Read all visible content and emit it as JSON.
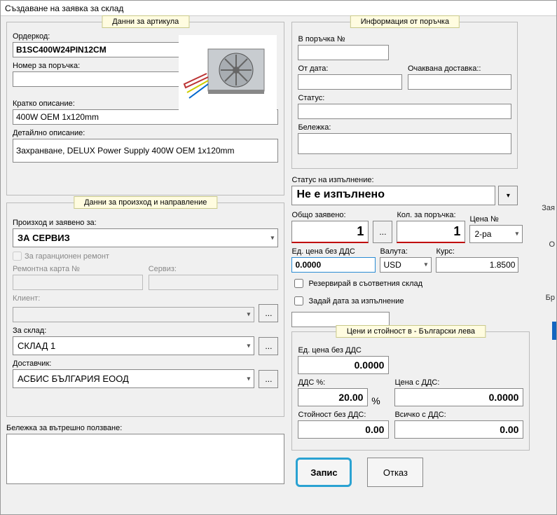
{
  "window": {
    "title": "Създаване на заявка за склад"
  },
  "article": {
    "legend": "Данни за артикула",
    "ordercode_label": "Ордеркод:",
    "ordercode": "B1SC400W24PIN12CM",
    "ordernum_label": "Номер за поръчка:",
    "ordernum": "",
    "short_label": "Кратко описание:",
    "short": "400W OEM 1x120mm",
    "detail_label": "Детайлно описание:",
    "detail": "Захранване, DELUX Power Supply 400W OEM 1x120mm"
  },
  "origin": {
    "legend": "Данни за произход и направление",
    "from_label": "Произход и заявено за:",
    "from": "ЗА СЕРВИЗ",
    "warranty_label": "За гаранционен ремонт",
    "repaircard_label": "Ремонтна карта №",
    "service_label": "Сервиз:",
    "repaircard": "",
    "service": "",
    "client_label": "Клиент:",
    "client": "",
    "for_sklad_label": "За склад:",
    "for_sklad": "СКЛАД 1",
    "supplier_label": "Доставчик:",
    "supplier": "АСБИС БЪЛГАРИЯ ЕООД"
  },
  "note": {
    "label": "Бележка за вътрешно ползване:",
    "value": ""
  },
  "orderinfo": {
    "legend": "Информация от поръчка",
    "ordno_label": "В поръчка №",
    "ordno": "",
    "fromdate_label": "От дата:",
    "fromdate": "",
    "expdeliv_label": "Очаквана доставка::",
    "expdeliv": "",
    "status_label": "Статус:",
    "status": "",
    "note_label": "Бележка:",
    "note": ""
  },
  "exec": {
    "status_label": "Статус на изпълнение:",
    "status": "Не е изпълнено",
    "total_label": "Общо заявено:",
    "total": "1",
    "qty_label": "Кол. за поръчка:",
    "qty": "1",
    "priceno_label": "Цена №",
    "priceno": "2-ра",
    "unitprice_label": "Ед. цена без ДДС",
    "unitprice": "0.0000",
    "currency_label": "Валута:",
    "currency": "USD",
    "rate_label": "Курс:",
    "rate": "1.8500",
    "reserve_label": "Резервирай в съответния склад",
    "setdate_label": "Задай дата за изпълнение",
    "datefield": ""
  },
  "prices": {
    "legend": "Цени и стойност в - Български лева",
    "unit_label": "Ед. цена без ДДС",
    "unit": "0.0000",
    "vatpct_label": "ДДС %:",
    "vatpct": "20.00",
    "withvat_label": "Цена с ДДС:",
    "withvat": "0.0000",
    "total_label": "Стойност без ДДС:",
    "total": "0.00",
    "totalvat_label": "Всичко с ДДС:",
    "totalvat": "0.00"
  },
  "buttons": {
    "save": "Запис",
    "cancel": "Отказ"
  },
  "sidebar": {
    "tab": "Зая",
    "o": "О",
    "br": "Бр"
  }
}
